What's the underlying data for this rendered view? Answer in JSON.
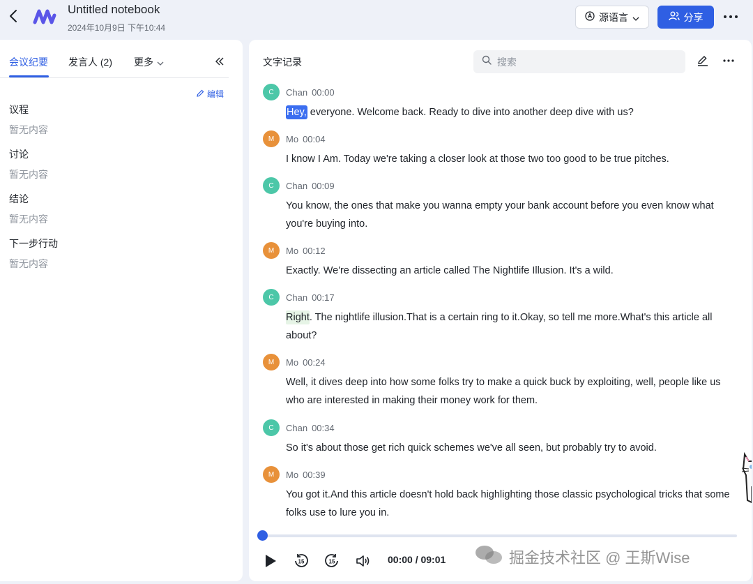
{
  "header": {
    "title": "Untitled notebook",
    "datetime": "2024年10月9日 下午10:44",
    "lang_button": "源语言",
    "share_button": "分享"
  },
  "left": {
    "tabs": [
      {
        "label": "会议纪要",
        "active": true
      },
      {
        "label": "发言人 (2)",
        "active": false
      },
      {
        "label": "更多",
        "active": false
      }
    ],
    "edit_label": "编辑",
    "sections": [
      {
        "title": "议程",
        "empty": "暂无内容"
      },
      {
        "title": "讨论",
        "empty": "暂无内容"
      },
      {
        "title": "结论",
        "empty": "暂无内容"
      },
      {
        "title": "下一步行动",
        "empty": "暂无内容"
      }
    ]
  },
  "transcript": {
    "title": "文字记录",
    "search_placeholder": "搜索",
    "entries": [
      {
        "initial": "C",
        "speaker": "Chan",
        "time": "00:00",
        "highlight": "Hey,",
        "text": " everyone. Welcome back. Ready to dive into another deep dive with us?"
      },
      {
        "initial": "M",
        "speaker": "Mo",
        "time": "00:04",
        "text": "I know I Am. Today we're taking a closer look at those two too good to be true pitches."
      },
      {
        "initial": "C",
        "speaker": "Chan",
        "time": "00:09",
        "text": "You know, the ones that make you wanna empty your bank account before you even know what you're buying into."
      },
      {
        "initial": "M",
        "speaker": "Mo",
        "time": "00:12",
        "text": "Exactly. We're dissecting an article called The Nightlife Illusion. It's a wild."
      },
      {
        "initial": "C",
        "speaker": "Chan",
        "time": "00:17",
        "highlight_green": "Right",
        "text": ". The nightlife illusion.That is a certain ring to it.Okay, so tell me more.What's this article all about?"
      },
      {
        "initial": "M",
        "speaker": "Mo",
        "time": "00:24",
        "text": "Well, it dives deep into how some folks try to make a quick buck by exploiting, well, people like us who are interested in making their money work for them."
      },
      {
        "initial": "C",
        "speaker": "Chan",
        "time": "00:34",
        "text": "So it's about those get rich quick schemes we've all seen, but probably try to avoid."
      },
      {
        "initial": "M",
        "speaker": "Mo",
        "time": "00:39",
        "text": "You got it.And this article doesn't hold back highlighting those classic psychological tricks that some folks use to lure you in."
      }
    ]
  },
  "player": {
    "time_readout": "00:00 / 09:01",
    "progress_fraction": 0.0,
    "skip_back_seconds": "15",
    "skip_forward_seconds": "15"
  },
  "watermark": "掘金技术社区 @ 王斯Wise",
  "colors": {
    "accent": "#2f5fe3",
    "avatar_chan": "#4cc7a8",
    "avatar_mo": "#e8913a"
  }
}
